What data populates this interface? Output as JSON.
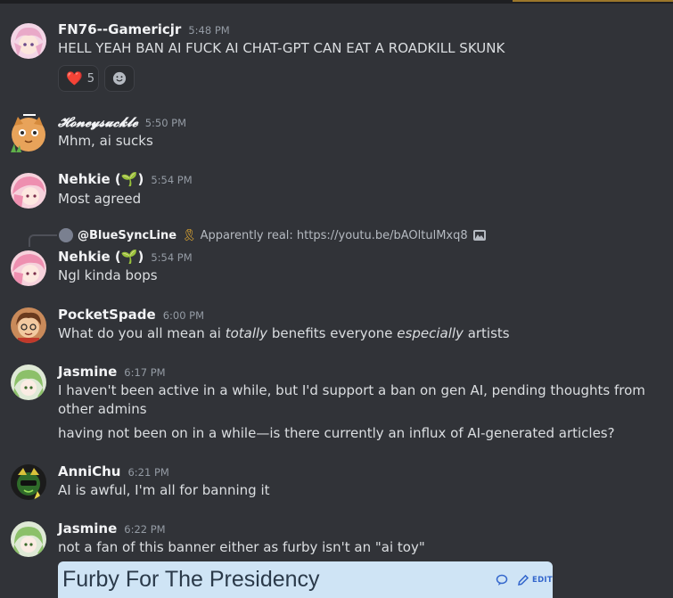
{
  "messages": [
    {
      "username": "FN76--Gamericjr",
      "time": "5:48 PM",
      "text": "HELL YEAH BAN AI FUCK AI CHAT-GPT CAN EAT A ROADKILL SKUNK",
      "reactions": [
        {
          "emoji": "❤️",
          "count": "5"
        }
      ]
    },
    {
      "username": "𝓗𝓸𝓷𝓮𝔂𝓼𝓾𝓬𝓴𝓵𝓮",
      "time": "5:50 PM",
      "text": "Mhm, ai sucks"
    },
    {
      "username": "Nehkie (🌱)",
      "time": "5:54 PM",
      "text": "Most agreed"
    },
    {
      "reply": {
        "author": "@BlueSyncLine",
        "badge": "🎗",
        "text": "Apparently real: https://youtu.be/bAOltulMxq8"
      },
      "username": "Nehkie (🌱)",
      "time": "5:54 PM",
      "text": "Ngl kinda bops"
    },
    {
      "username": "PocketSpade",
      "time": "6:00 PM",
      "text_parts": [
        "What do you all mean ai ",
        "totally",
        " benefits everyone ",
        "especially",
        " artists"
      ]
    },
    {
      "username": "Jasmine",
      "time": "6:17 PM",
      "text": "I haven't been active in a while, but I'd support a ban on gen AI, pending thoughts from other admins",
      "text2": "having not been on in a while—is there currently an influx of AI-generated articles?"
    },
    {
      "username": "AnniChu",
      "time": "6:21 PM",
      "text": "AI is awful, I'm all for banning it"
    },
    {
      "username": "Jasmine",
      "time": "6:22 PM",
      "text": "not a fan of this banner either as furby isn't an \"ai toy\"",
      "embed": {
        "title": "Furby For The Presidency",
        "edit_label": "EDIT"
      }
    }
  ]
}
